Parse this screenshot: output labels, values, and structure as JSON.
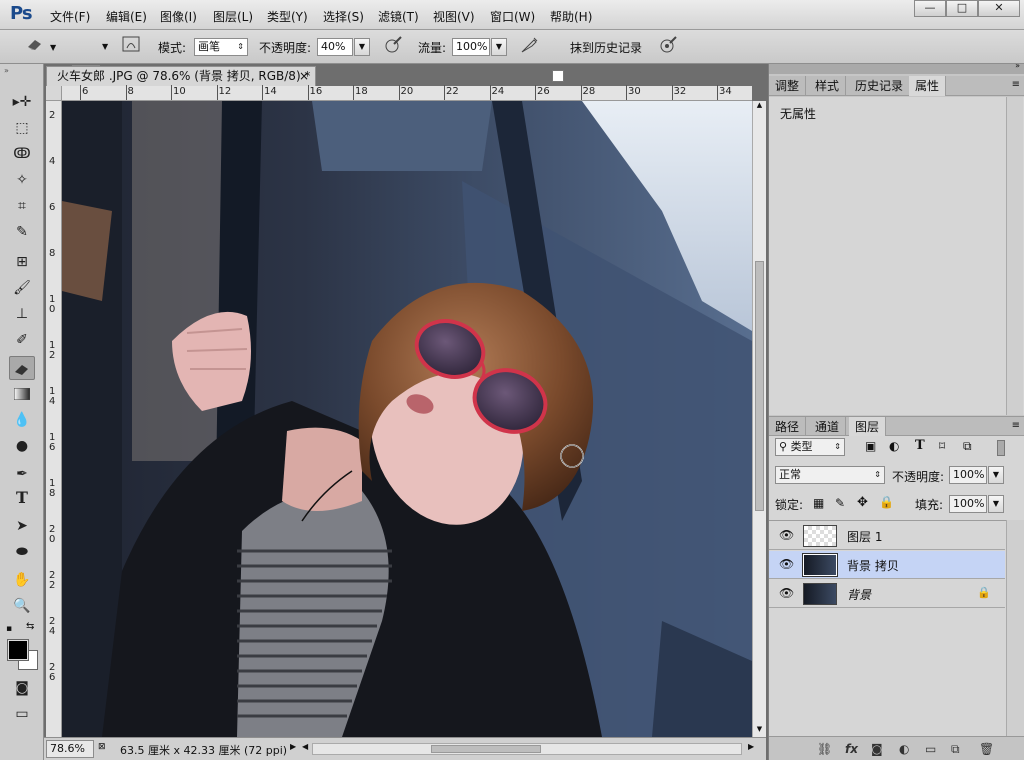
{
  "app": {
    "logo": "Ps"
  },
  "menu": [
    "文件(F)",
    "编辑(E)",
    "图像(I)",
    "图层(L)",
    "类型(Y)",
    "选择(S)",
    "滤镜(T)",
    "视图(V)",
    "窗口(W)",
    "帮助(H)"
  ],
  "window_controls": {
    "minimize": "—",
    "maximize": "□",
    "close": "✕"
  },
  "options": {
    "brush_size": "40",
    "mode_label": "模式:",
    "mode_value": "画笔",
    "opacity_label": "不透明度:",
    "opacity_value": "40%",
    "flow_label": "流量:",
    "flow_value": "100%",
    "erase_history_label": "抹到历史记录"
  },
  "document": {
    "tab_title": "火车女郎 .JPG @ 78.6% (背景 拷贝, RGB/8) *",
    "close": "×",
    "ruler_top": [
      "6",
      "8",
      "10",
      "12",
      "14",
      "16",
      "18",
      "20",
      "22",
      "24",
      "26",
      "28",
      "30",
      "32",
      "34"
    ],
    "ruler_left": [
      "2",
      "4",
      "6",
      "8",
      "1\n0",
      "1\n2",
      "1\n4",
      "1\n6",
      "1\n8",
      "2\n0",
      "2\n2",
      "2\n4",
      "2\n6"
    ]
  },
  "status": {
    "zoom": "78.6%",
    "doc_size": "63.5 厘米 x 42.33 厘米 (72 ppi)"
  },
  "properties_panel": {
    "tabs": [
      "调整",
      "样式",
      "历史记录",
      "属性"
    ],
    "active_tab": "属性",
    "content": "无属性"
  },
  "layers_panel": {
    "tabs": [
      "路径",
      "通道",
      "图层"
    ],
    "active_tab": "图层",
    "filter_kind": "类型",
    "blend_mode": "正常",
    "opacity_label": "不透明度:",
    "opacity_value": "100%",
    "lock_label": "锁定:",
    "fill_label": "填充:",
    "fill_value": "100%",
    "layers": [
      {
        "name": "图层 1",
        "visible": true,
        "selected": false,
        "locked": false
      },
      {
        "name": "背景 拷贝",
        "visible": true,
        "selected": true,
        "locked": false
      },
      {
        "name": "背景",
        "visible": true,
        "selected": false,
        "locked": true
      }
    ]
  },
  "colors": {
    "selection": "#c5d4f5",
    "foreground": "#000000",
    "background": "#ffffff"
  }
}
